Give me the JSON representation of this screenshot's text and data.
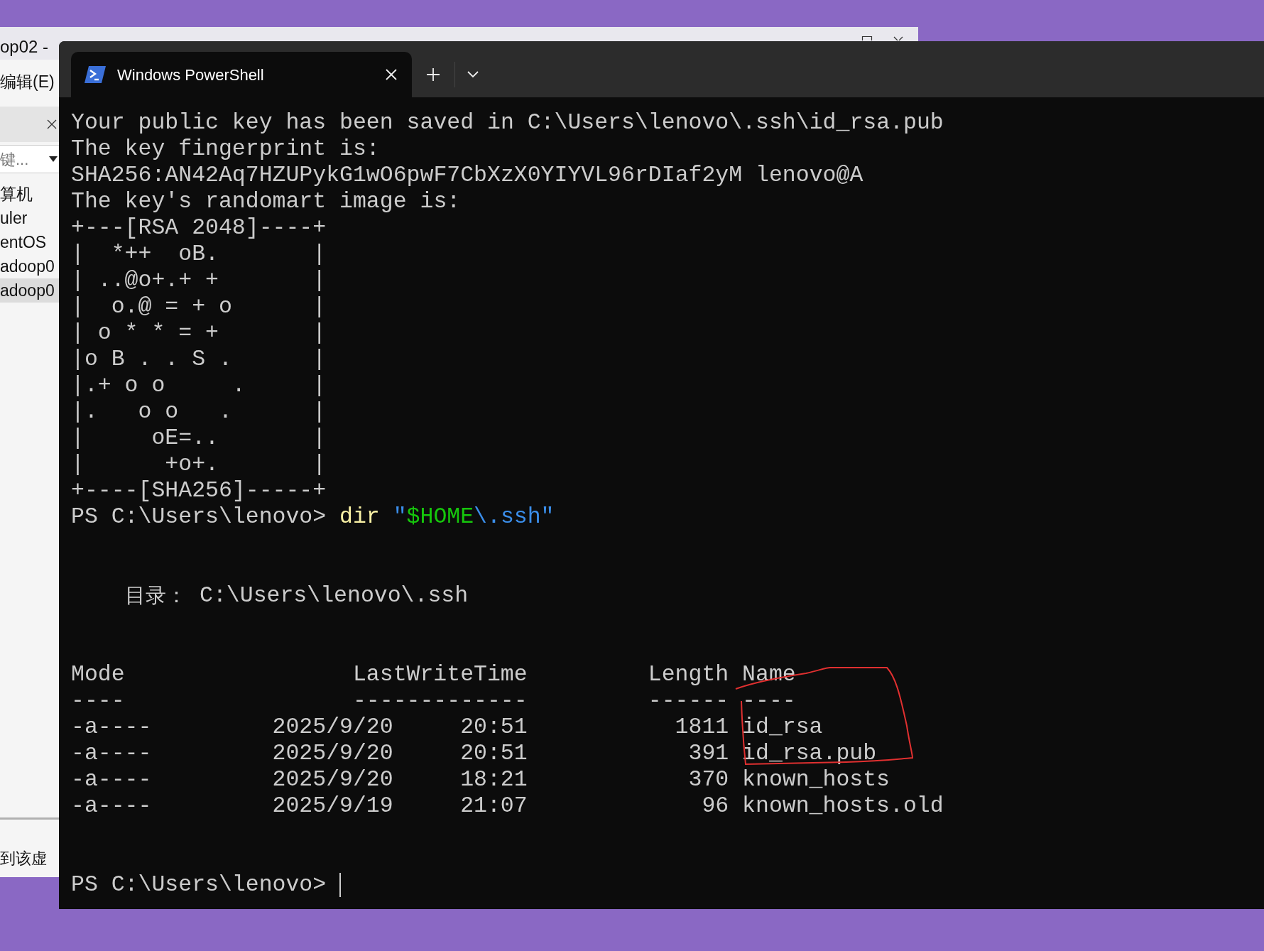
{
  "background_window": {
    "title": "op02 -",
    "menu": [
      "编辑(E)"
    ],
    "search": {
      "placeholder": "键..."
    },
    "library_items": [
      {
        "label": "算机",
        "selected": false
      },
      {
        "label": "uler",
        "selected": false
      },
      {
        "label": "entOS",
        "selected": false
      },
      {
        "label": "adoop0",
        "selected": false
      },
      {
        "label": "adoop0",
        "selected": true
      }
    ],
    "status_text": "到该虚"
  },
  "terminal": {
    "tabs": [
      {
        "title": "Windows PowerShell",
        "selected": true
      }
    ],
    "lines": [
      {
        "kind": "output",
        "text": "Your public key has been saved in C:\\Users\\lenovo\\.ssh\\id_rsa.pub"
      },
      {
        "kind": "output",
        "text": "The key fingerprint is:"
      },
      {
        "kind": "output",
        "text": "SHA256:AN42Aq7HZUPykG1wO6pwF7CbXzX0YIYVL96rDIaf2yM lenovo@A"
      },
      {
        "kind": "output",
        "text": "The key's randomart image is:"
      },
      {
        "kind": "output",
        "text": "+---[RSA 2048]----+"
      },
      {
        "kind": "output",
        "text": "|  *++  oB.       |"
      },
      {
        "kind": "output",
        "text": "| ..@o+.+ +       |"
      },
      {
        "kind": "output",
        "text": "|  o.@ = + o      |"
      },
      {
        "kind": "output",
        "text": "| o * * = +       |"
      },
      {
        "kind": "output",
        "text": "|o B . . S .      |"
      },
      {
        "kind": "output",
        "text": "|.+ o o     .     |"
      },
      {
        "kind": "output",
        "text": "|.   o o   .      |"
      },
      {
        "kind": "output",
        "text": "|     oE=..       |"
      },
      {
        "kind": "output",
        "text": "|      +o+.       |"
      },
      {
        "kind": "output",
        "text": "+----[SHA256]-----+"
      },
      {
        "kind": "command",
        "prompt": "PS C:\\Users\\lenovo>",
        "segments": [
          {
            "text": "dir",
            "color": "#f9f1a5"
          },
          {
            "text": " \"",
            "color": "#3b8eea"
          },
          {
            "text": "$HOME",
            "color": "#16c60c"
          },
          {
            "text": "\\.ssh\"",
            "color": "#3b8eea"
          }
        ]
      },
      {
        "kind": "blank"
      },
      {
        "kind": "blank"
      },
      {
        "kind": "directory",
        "label": "目录：",
        "path": "C:\\Users\\lenovo\\.ssh"
      },
      {
        "kind": "blank"
      },
      {
        "kind": "blank"
      },
      {
        "kind": "listing",
        "columns": [
          {
            "label": "Mode",
            "rule": "----"
          },
          {
            "label": "LastWriteTime",
            "rule": "-------------"
          },
          {
            "label": "Length",
            "rule": "------"
          },
          {
            "label": "Name",
            "rule": "----"
          }
        ],
        "rows": [
          {
            "mode": "-a----",
            "date": "2025/9/20",
            "time": "20:51",
            "length": "1811",
            "name": "id_rsa"
          },
          {
            "mode": "-a----",
            "date": "2025/9/20",
            "time": "20:51",
            "length": "391",
            "name": "id_rsa.pub"
          },
          {
            "mode": "-a----",
            "date": "2025/9/20",
            "time": "18:21",
            "length": "370",
            "name": "known_hosts"
          },
          {
            "mode": "-a----",
            "date": "2025/9/19",
            "time": "21:07",
            "length": "96",
            "name": "known_hosts.old"
          }
        ]
      },
      {
        "kind": "blank"
      },
      {
        "kind": "blank"
      },
      {
        "kind": "prompt",
        "prompt": "PS C:\\Users\\lenovo>"
      }
    ]
  }
}
